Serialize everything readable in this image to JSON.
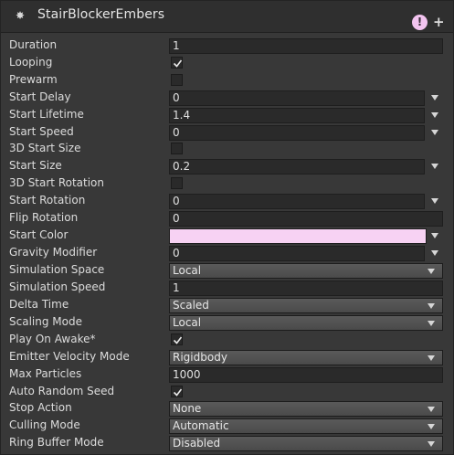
{
  "header": {
    "title": "StairBlockerEmbers",
    "warn_glyph": "!",
    "add_glyph": "+"
  },
  "rows": [
    {
      "label": "Duration",
      "value": "1"
    },
    {
      "label": "Looping",
      "checked": true
    },
    {
      "label": "Prewarm",
      "checked": false
    },
    {
      "label": "Start Delay",
      "value": "0"
    },
    {
      "label": "Start Lifetime",
      "value": "1.4"
    },
    {
      "label": "Start Speed",
      "value": "0"
    },
    {
      "label": "3D Start Size",
      "checked": false
    },
    {
      "label": "Start Size",
      "value": "0.2"
    },
    {
      "label": "3D Start Rotation",
      "checked": false
    },
    {
      "label": "Start Rotation",
      "value": "0"
    },
    {
      "label": "Flip Rotation",
      "value": "0"
    },
    {
      "label": "Start Color",
      "color": "#f7d2f3"
    },
    {
      "label": "Gravity Modifier",
      "value": "0"
    },
    {
      "label": "Simulation Space",
      "value": "Local"
    },
    {
      "label": "Simulation Speed",
      "value": "1"
    },
    {
      "label": "Delta Time",
      "value": "Scaled"
    },
    {
      "label": "Scaling Mode",
      "value": "Local"
    },
    {
      "label": "Play On Awake*",
      "checked": true
    },
    {
      "label": "Emitter Velocity Mode",
      "value": "Rigidbody"
    },
    {
      "label": "Max Particles",
      "value": "1000"
    },
    {
      "label": "Auto Random Seed",
      "checked": true
    },
    {
      "label": "Stop Action",
      "value": "None"
    },
    {
      "label": "Culling Mode",
      "value": "Automatic"
    },
    {
      "label": "Ring Buffer Mode",
      "value": "Disabled"
    }
  ]
}
